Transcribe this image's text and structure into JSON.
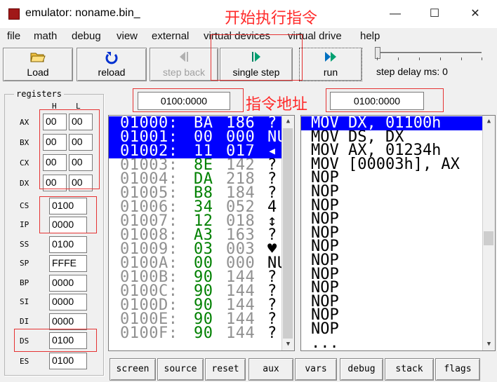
{
  "window": {
    "title": "emulator: noname.bin_",
    "minimize": "—",
    "maximize": "☐",
    "close": "✕"
  },
  "annotations": {
    "start_step": "开始执行指令",
    "instruction_address": "指令地址"
  },
  "menu": [
    "file",
    "math",
    "debug",
    "view",
    "external",
    "virtual devices",
    "virtual drive",
    "help"
  ],
  "toolbar": {
    "load": {
      "label": "Load",
      "icon": "open-folder-icon"
    },
    "reload": {
      "label": "reload",
      "icon": "reload-icon"
    },
    "step_back": {
      "label": "step back",
      "icon": "step-back-icon"
    },
    "single_step": {
      "label": "single step",
      "icon": "single-step-icon"
    },
    "run": {
      "label": "run",
      "icon": "run-icon"
    },
    "step_delay": "step delay ms: 0"
  },
  "step_delay_ms": 0,
  "address_left": "0100:0000",
  "address_right": "0100:0000",
  "registers": {
    "title": "registers",
    "col_h": "H",
    "col_l": "L",
    "gp": [
      {
        "name": "AX",
        "h": "00",
        "l": "00"
      },
      {
        "name": "BX",
        "h": "00",
        "l": "00"
      },
      {
        "name": "CX",
        "h": "00",
        "l": "00"
      },
      {
        "name": "DX",
        "h": "00",
        "l": "00"
      }
    ],
    "seg": [
      {
        "name": "CS",
        "value": "0100"
      },
      {
        "name": "IP",
        "value": "0000"
      },
      {
        "name": "SS",
        "value": "0100"
      },
      {
        "name": "SP",
        "value": "FFFE"
      },
      {
        "name": "BP",
        "value": "0000"
      },
      {
        "name": "SI",
        "value": "0000"
      },
      {
        "name": "DI",
        "value": "0000"
      },
      {
        "name": "DS",
        "value": "0100"
      },
      {
        "name": "ES",
        "value": "0100"
      }
    ]
  },
  "memory": [
    {
      "addr": "01000:",
      "hex": "BA",
      "dec": "186",
      "chr": "?"
    },
    {
      "addr": "01001:",
      "hex": "00",
      "dec": "000",
      "chr": "NU"
    },
    {
      "addr": "01002:",
      "hex": "11",
      "dec": "017",
      "chr": "◂"
    },
    {
      "addr": "01003:",
      "hex": "8E",
      "dec": "142",
      "chr": "?"
    },
    {
      "addr": "01004:",
      "hex": "DA",
      "dec": "218",
      "chr": "?"
    },
    {
      "addr": "01005:",
      "hex": "B8",
      "dec": "184",
      "chr": "?"
    },
    {
      "addr": "01006:",
      "hex": "34",
      "dec": "052",
      "chr": "4"
    },
    {
      "addr": "01007:",
      "hex": "12",
      "dec": "018",
      "chr": "↕"
    },
    {
      "addr": "01008:",
      "hex": "A3",
      "dec": "163",
      "chr": "?"
    },
    {
      "addr": "01009:",
      "hex": "03",
      "dec": "003",
      "chr": "♥"
    },
    {
      "addr": "0100A:",
      "hex": "00",
      "dec": "000",
      "chr": "NU"
    },
    {
      "addr": "0100B:",
      "hex": "90",
      "dec": "144",
      "chr": "?"
    },
    {
      "addr": "0100C:",
      "hex": "90",
      "dec": "144",
      "chr": "?"
    },
    {
      "addr": "0100D:",
      "hex": "90",
      "dec": "144",
      "chr": "?"
    },
    {
      "addr": "0100E:",
      "hex": "90",
      "dec": "144",
      "chr": "?"
    },
    {
      "addr": "0100F:",
      "hex": "90",
      "dec": "144",
      "chr": "?"
    }
  ],
  "disassembly": [
    "MOV DX, 01100h",
    "MOV DS, DX",
    "MOV AX, 01234h",
    "MOV [00003h], AX",
    "NOP",
    "NOP",
    "NOP",
    "NOP",
    "NOP",
    "NOP",
    "NOP",
    "NOP",
    "NOP",
    "NOP",
    "NOP",
    "NOP",
    "..."
  ],
  "bottom_buttons": [
    "screen",
    "source",
    "reset",
    "aux",
    "vars",
    "debug",
    "stack",
    "flags"
  ],
  "colors": {
    "selection": "#0000ff",
    "hex_values": "#008000",
    "annotation": "#ff2a2a"
  }
}
